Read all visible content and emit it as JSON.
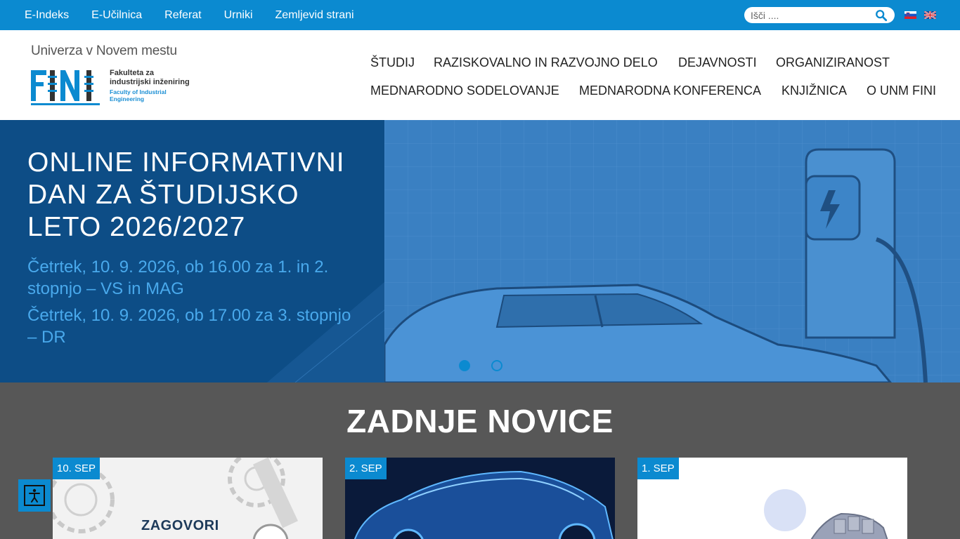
{
  "topbar": {
    "links": [
      "E-Indeks",
      "E-Učilnica",
      "Referat",
      "Urniki",
      "Zemljevid strani"
    ],
    "search_placeholder": "Išči ....",
    "languages": [
      "sl",
      "en"
    ]
  },
  "logo": {
    "university": "Univerza v Novem mestu",
    "faculty_line1": "Fakulteta za",
    "faculty_line2": "industrijski inženiring",
    "faculty_en": "Faculty of Industrial Engineering",
    "brand_color": "#0b8ad0"
  },
  "nav": {
    "row1": [
      "ŠTUDIJ",
      "RAZISKOVALNO IN RAZVOJNO DELO",
      "DEJAVNOSTI",
      "ORGANIZIRANOST"
    ],
    "row2": [
      "MEDNARODNO SODELOVANJE",
      "MEDNARODNA KONFERENCA",
      "KNJIŽNICA",
      "O UNM FINI"
    ]
  },
  "hero": {
    "title": "ONLINE INFORMATIVNI DAN ZA ŠTUDIJSKO LETO 2026/2027",
    "subtitle1": "Četrtek, 10. 9. 2026, ob 16.00 za 1. in 2. stopnjo – VS in MAG",
    "subtitle2": "Četrtek, 10. 9. 2026, ob 17.00 za 3. stopnjo – DR",
    "slides": 2,
    "active_slide": 1
  },
  "news": {
    "heading": "ZADNJE NOVICE",
    "cards": [
      {
        "date": "10. SEP",
        "text": "ZAGOVORI"
      },
      {
        "date": "2. SEP",
        "text": ""
      },
      {
        "date": "1. SEP",
        "text": ""
      }
    ]
  },
  "accessibility": {
    "icon": "accessibility-icon"
  },
  "colors": {
    "accent": "#0b8ad0",
    "hero_dark": "#0d4d86",
    "hero_text": "#49a9ec",
    "news_bg": "#575757"
  }
}
